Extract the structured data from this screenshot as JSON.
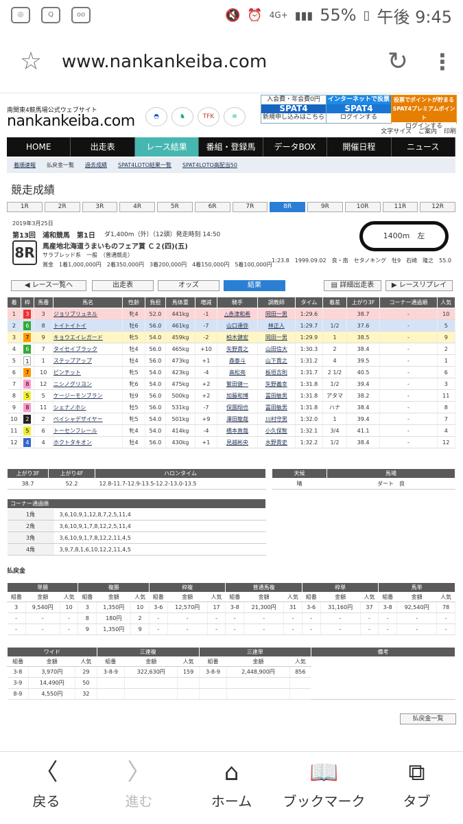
{
  "status": {
    "left_icons": [
      "nfc-icon",
      "shield-icon",
      "voicemail-icon"
    ],
    "right_text": "55%",
    "time": "午後 9:45",
    "network": "4G+"
  },
  "browser": {
    "url": "www.nankankeiba.com"
  },
  "site": {
    "sub": "南関東4競馬場公式ウェブサイト",
    "logo": "nankankeiba.com",
    "banners": [
      {
        "top": "入会費・年会費0円",
        "mid": "SPAT4",
        "bot": "新規申し込みはこちら",
        "color": "#1565c0"
      },
      {
        "top": "インターネットで投票",
        "mid": "SPAT4",
        "bot": "ログインする",
        "color": "#1976d2"
      },
      {
        "top": "投票でポイントが貯まる",
        "mid": "SPAT4プレミアムポイント",
        "bot": "ログインする",
        "color": "#e67e00"
      }
    ],
    "util": [
      "文字サイズ",
      "ご案内",
      "印刷"
    ]
  },
  "nav": [
    "HOME",
    "出走表",
    "レース結果",
    "番組・登録馬",
    "データBOX",
    "開催日程",
    "ニュース"
  ],
  "subnav": [
    "着順速報",
    "払戻金一覧",
    "過去成績",
    "SPAT4LOTO結果一覧",
    "SPAT4LOTO高配当50"
  ],
  "page_title": "競走成績",
  "race_tabs": [
    "1R",
    "2R",
    "3R",
    "4R",
    "5R",
    "6R",
    "7R",
    "8R",
    "9R",
    "10R",
    "11R",
    "12R"
  ],
  "race": {
    "date": "2019年3月25日",
    "kai": "第13回　浦和競馬　第1日",
    "dist": "ダ1,400m（外）（12頭）発走時刻 14:50",
    "num": "8R",
    "name": "馬産地北海道うまいものフェア賞 Ｃ２(四)(五)",
    "cls": "サラブレッド系　一般　（普通競走）",
    "prize": "賞金　1着1,000,000円　2着350,000円　3着200,000円　4着150,000円　5着100,000円",
    "course": "1400m　左",
    "record": "1:23.8　1999.09.02　良・南　セタノキング　牡9　石崎　隆之　55.0"
  },
  "buttons": {
    "back": "レース一覧へ",
    "entry": "出走表",
    "odds": "オッズ",
    "result": "結果",
    "detail": "詳細出走表",
    "replay": "レースリプレイ"
  },
  "result_headers": [
    "着",
    "枠",
    "馬番",
    "馬名",
    "性齢",
    "負担",
    "馬体重",
    "増減",
    "騎手",
    "調教師",
    "タイム",
    "着差",
    "上がり3F",
    "コーナー通過順",
    "人気"
  ],
  "results": [
    [
      "1",
      "3",
      "3",
      "ジョリブリュネル",
      "牝4",
      "52.0",
      "441kg",
      "-1",
      "△赤津和希",
      "岡田一男",
      "1:29.6",
      "",
      "38.7",
      "-",
      "10"
    ],
    [
      "2",
      "6",
      "8",
      "トイトイトイ",
      "牡6",
      "56.0",
      "461kg",
      "-7",
      "山口達弥",
      "林正人",
      "1:29.7",
      "1/2",
      "37.6",
      "-",
      "5"
    ],
    [
      "3",
      "7",
      "9",
      "キョウエイレガード",
      "牝5",
      "54.0",
      "459kg",
      "-2",
      "柏木健宏",
      "岡田一男",
      "1:29.9",
      "1",
      "38.5",
      "-",
      "9"
    ],
    [
      "4",
      "6",
      "7",
      "タイセイブラック",
      "牡4",
      "56.0",
      "465kg",
      "+10",
      "矢野貴之",
      "山田信大",
      "1:30.3",
      "2",
      "38.4",
      "-",
      "2"
    ],
    [
      "5",
      "1",
      "1",
      "ステップアップ",
      "牡4",
      "56.0",
      "473kg",
      "+1",
      "森泰斗",
      "山下貴之",
      "1:31.2",
      "4",
      "39.5",
      "-",
      "1"
    ],
    [
      "6",
      "7",
      "10",
      "ピンチット",
      "牝5",
      "54.0",
      "423kg",
      "-4",
      "高松亮",
      "板垣吉則",
      "1:31.7",
      "2 1/2",
      "40.5",
      "-",
      "6"
    ],
    [
      "7",
      "8",
      "12",
      "ニシノグリヨン",
      "牝6",
      "54.0",
      "475kg",
      "+2",
      "繁田健一",
      "矢野義幸",
      "1:31.8",
      "1/2",
      "39.4",
      "-",
      "3"
    ],
    [
      "8",
      "5",
      "5",
      "ケージーモンブラン",
      "牡9",
      "56.0",
      "500kg",
      "+2",
      "加藤和博",
      "冨田敏男",
      "1:31.8",
      "アタマ",
      "38.2",
      "-",
      "11"
    ],
    [
      "9",
      "8",
      "11",
      "シェナノホシ",
      "牡5",
      "56.0",
      "531kg",
      "-7",
      "保園翔也",
      "冨田敏男",
      "1:31.8",
      "ハナ",
      "38.4",
      "-",
      "8"
    ],
    [
      "10",
      "2",
      "2",
      "ペイシャデザイヤー",
      "牝5",
      "54.0",
      "501kg",
      "+9",
      "澤田龍哉",
      "川村守男",
      "1:32.0",
      "1",
      "39.4",
      "-",
      "7"
    ],
    [
      "11",
      "5",
      "6",
      "トーセンフレール",
      "牝4",
      "54.0",
      "414kg",
      "-4",
      "橋本直哉",
      "小久保智",
      "1:32.1",
      "3/4",
      "41.1",
      "-",
      "4"
    ],
    [
      "12",
      "4",
      "4",
      "ホクトタキオン",
      "牡4",
      "56.0",
      "430kg",
      "+1",
      "見越彬央",
      "水野貴史",
      "1:32.2",
      "1/2",
      "38.4",
      "-",
      "12"
    ]
  ],
  "stats": {
    "headers": [
      "上がり3F",
      "上がり4F",
      "ハロンタイム"
    ],
    "values": [
      "38.7",
      "52.2",
      "12.8-11.7-12.9-13.5-12.2-13.0-13.5"
    ]
  },
  "weather": {
    "headers": [
      "天候",
      "馬場"
    ],
    "values": [
      "晴",
      "ダート　良"
    ]
  },
  "corner": {
    "title": "コーナー通過順",
    "rows": [
      [
        "1角",
        "3,6,10,9,1,12,8,7,2,5,11,4"
      ],
      [
        "2角",
        "3,6,10,9,1,7,8,12,2,5,11,4"
      ],
      [
        "3角",
        "3,6,10,9,1,7,8,12,2,11,4,5"
      ],
      [
        "4角",
        "3,9,7,8,1,6,10,12,2,11,4,5"
      ]
    ]
  },
  "payout": {
    "title": "払戻金",
    "groups1": [
      "単勝",
      "複勝",
      "枠複",
      "普通馬複",
      "枠単",
      "馬単"
    ],
    "sub": [
      "組番",
      "金額",
      "人気"
    ],
    "rows1": [
      [
        "3",
        "9,540円",
        "10",
        "3",
        "1,350円",
        "10",
        "3-6",
        "12,570円",
        "17",
        "3-8",
        "21,300円",
        "31",
        "3-6",
        "31,160円",
        "37",
        "3-8",
        "92,540円",
        "78"
      ],
      [
        "-",
        "-",
        "-",
        "8",
        "180円",
        "2",
        "-",
        "-",
        "-",
        "-",
        "-",
        "-",
        "-",
        "-",
        "-",
        "-",
        "-",
        "-"
      ],
      [
        "-",
        "-",
        "-",
        "9",
        "1,350円",
        "9",
        "-",
        "-",
        "-",
        "-",
        "-",
        "-",
        "-",
        "-",
        "-",
        "-",
        "-",
        "-"
      ]
    ],
    "groups2": [
      "ワイド",
      "三連複",
      "三連単",
      "備考"
    ],
    "rows2": [
      [
        "3-8",
        "3,970円",
        "29",
        "3-8-9",
        "322,630円",
        "159",
        "3-8-9",
        "2,448,900円",
        "856"
      ],
      [
        "3-9",
        "14,490円",
        "50",
        "",
        "",
        "",
        "",
        "",
        ""
      ],
      [
        "8-9",
        "4,550円",
        "32",
        "",
        "",
        "",
        "",
        "",
        ""
      ]
    ],
    "list_btn": "払戻金一覧"
  },
  "bottom_nav": [
    {
      "label": "戻る",
      "icon": "back-icon"
    },
    {
      "label": "進む",
      "icon": "forward-icon"
    },
    {
      "label": "ホーム",
      "icon": "home-icon"
    },
    {
      "label": "ブックマーク",
      "icon": "bookmark-icon"
    },
    {
      "label": "タブ",
      "icon": "tabs-icon"
    }
  ]
}
